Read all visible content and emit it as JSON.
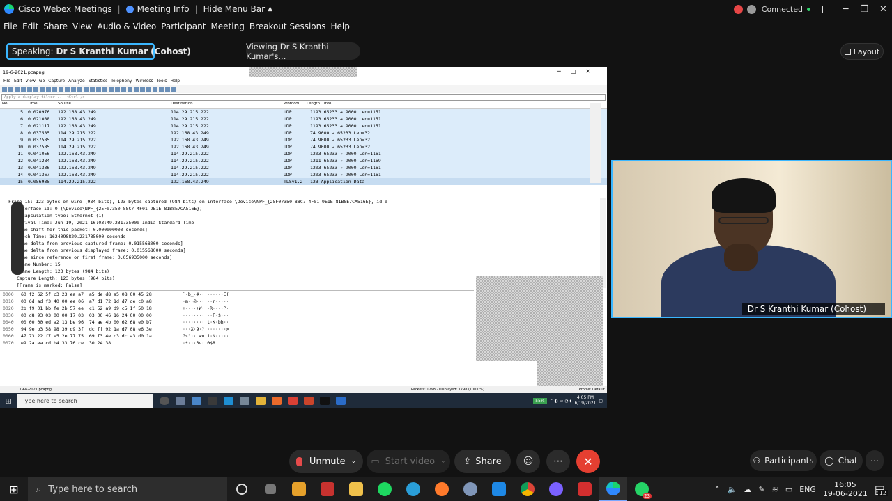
{
  "webex": {
    "app_title": "Cisco Webex Meetings",
    "meeting_info": "Meeting Info",
    "hide_menu_bar": "Hide Menu Bar",
    "status": "Connected",
    "menu": [
      "File",
      "Edit",
      "Share",
      "View",
      "Audio & Video",
      "Participant",
      "Meeting",
      "Breakout Sessions",
      "Help"
    ],
    "speaking_prefix": "Speaking:",
    "speaking_name": "Dr S Kranthi Kumar (Cohost)",
    "viewing": "Viewing Dr S Kranthi Kumar's...",
    "layout": "Layout",
    "video_label": "Dr S Kranthi Kumar  (Cohost)",
    "controls": {
      "unmute": "Unmute",
      "start_video": "Start video",
      "share": "Share",
      "participants": "Participants",
      "chat": "Chat"
    },
    "accent": "#3ab6ff",
    "end_color": "#e53f31"
  },
  "wireshark": {
    "file_title": "19-6-2021.pcapng",
    "menu": [
      "File",
      "Edit",
      "View",
      "Go",
      "Capture",
      "Analyze",
      "Statistics",
      "Telephony",
      "Wireless",
      "Tools",
      "Help"
    ],
    "filter_placeholder": "Apply a display filter ... <Ctrl-/>",
    "columns": [
      "No.",
      "Time",
      "Source",
      "Destination",
      "Protocol",
      "Length",
      "Info"
    ],
    "packets": [
      {
        "no": "5",
        "time": "0.020976",
        "src": "192.168.43.249",
        "dst": "114.29.215.222",
        "proto": "UDP",
        "info": "1193 65233 → 9000 Len=1151"
      },
      {
        "no": "6",
        "time": "0.021088",
        "src": "192.168.43.249",
        "dst": "114.29.215.222",
        "proto": "UDP",
        "info": "1193 65233 → 9000 Len=1151"
      },
      {
        "no": "7",
        "time": "0.021117",
        "src": "192.168.43.249",
        "dst": "114.29.215.222",
        "proto": "UDP",
        "info": "1193 65233 → 9000 Len=1151"
      },
      {
        "no": "8",
        "time": "0.037585",
        "src": "114.29.215.222",
        "dst": "192.168.43.249",
        "proto": "UDP",
        "info": "74 9000 → 65233 Len=32"
      },
      {
        "no": "9",
        "time": "0.037585",
        "src": "114.29.215.222",
        "dst": "192.168.43.249",
        "proto": "UDP",
        "info": "74 9000 → 65233 Len=32"
      },
      {
        "no": "10",
        "time": "0.037585",
        "src": "114.29.215.222",
        "dst": "192.168.43.249",
        "proto": "UDP",
        "info": "74 9000 → 65233 Len=32"
      },
      {
        "no": "11",
        "time": "0.041056",
        "src": "192.168.43.249",
        "dst": "114.29.215.222",
        "proto": "UDP",
        "info": "1203 65233 → 9000 Len=1161"
      },
      {
        "no": "12",
        "time": "0.041284",
        "src": "192.168.43.249",
        "dst": "114.29.215.222",
        "proto": "UDP",
        "info": "1211 65233 → 9000 Len=1169"
      },
      {
        "no": "13",
        "time": "0.041336",
        "src": "192.168.43.249",
        "dst": "114.29.215.222",
        "proto": "UDP",
        "info": "1203 65233 → 9000 Len=1161"
      },
      {
        "no": "14",
        "time": "0.041367",
        "src": "192.168.43.249",
        "dst": "114.29.215.222",
        "proto": "UDP",
        "info": "1203 65233 → 9000 Len=1161"
      },
      {
        "no": "15",
        "time": "0.056935",
        "src": "114.29.215.222",
        "dst": "192.168.43.249",
        "proto": "TLSv1.2",
        "info": "123 Application Data"
      }
    ],
    "details": [
      "Frame 15: 123 bytes on wire (984 bits), 123 bytes captured (984 bits) on interface \\Device\\NPF_{25F07350-88C7-4F01-9E1E-81B8E7CA516E}, id 0",
      "Interface id: 0 (\\Device\\NPF_{25F07350-88C7-4F01-9E1E-81B8E7CA516E})",
      "Encapsulation type: Ethernet (1)",
      "Arrival Time: Jun 19, 2021 16:03:49.231735000 India Standard Time",
      "Time shift for this packet: 0.000000000 seconds]",
      "Epoch Time: 1624098829.231735000 seconds",
      "Time delta from previous captured frame: 0.015568000 seconds]",
      "Time delta from previous displayed frame: 0.015568000 seconds]",
      "Time since reference or first frame: 0.056935000 seconds]",
      "Frame Number: 15",
      "Frame Length: 123 bytes (984 bits)",
      "Capture Length: 123 bytes (984 bits)",
      "[Frame is marked: False]"
    ],
    "hex": [
      {
        "off": "0000",
        "bytes": "60 f2 62 5f c3 23 ea a7  a5 de d8 a5 08 00 45 28",
        "ascii": "`·b_·#·· ······E("
      },
      {
        "off": "0010",
        "bytes": "00 6d ad f3 40 00 ee 06  a7 d1 72 1d d7 de c0 a8",
        "ascii": "·m··@··· ··r·····"
      },
      {
        "off": "0020",
        "bytes": "2b f9 01 bb fe 2b 57 ee  c1 52 a9 d9 c5 1f 50 18",
        "ascii": "+····+W· ·R····P·"
      },
      {
        "off": "0030",
        "bytes": "00 d8 93 03 00 00 17 03  03 00 46 16 24 00 00 00",
        "ascii": "········ ··F·$···"
      },
      {
        "off": "0040",
        "bytes": "00 00 00 ed a2 13 be 96  74 ae 4b 00 62 68 e0 b7",
        "ascii": "········ t·K·bh··"
      },
      {
        "off": "0050",
        "bytes": "94 9e b3 58 98 39 d9 3f  dc ff 92 1a d7 08 e6 3e",
        "ascii": "···X·9·? ·······>"
      },
      {
        "off": "0060",
        "bytes": "47 73 22 f7 e5 2e 77 75  69 f3 4e c3 dc a3 d0 1a",
        "ascii": "Gs\"··.wu i·N·····"
      },
      {
        "off": "0070",
        "bytes": "e9 2a ea cd b4 33 76 ce  30 24 38",
        "ascii": "·*···3v· 0$8"
      }
    ],
    "status_file": "19-6-2021.pcapng",
    "status_packets": "Packets: 1798 · Displayed: 1798 (100.0%)",
    "status_profile": "Profile: Default",
    "taskbar_search": "Type here to search",
    "battery": "55%",
    "time": "4:05 PM",
    "date": "6/19/2021"
  },
  "os": {
    "search_placeholder": "Type here to search",
    "lang": "ENG",
    "time": "16:05",
    "date": "19-06-2021",
    "notif_count": "12",
    "whatsapp_badge": "23"
  }
}
